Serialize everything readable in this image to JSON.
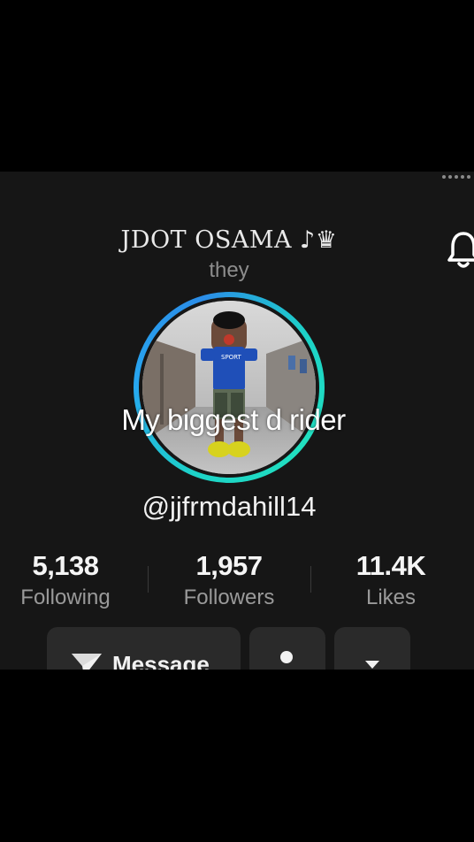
{
  "profile": {
    "display_name": "JDOT OSAMA ♪♛",
    "pronouns": "they",
    "username": "@jjfrmdahill14",
    "overlay_caption": "My biggest d rider"
  },
  "stats": [
    {
      "value": "5,138",
      "label": "Following"
    },
    {
      "value": "1,957",
      "label": "Followers"
    },
    {
      "value": "11.4K",
      "label": "Likes"
    }
  ],
  "actions": {
    "message_label": "Message"
  },
  "icons": {
    "top_right": "more-dots-icon",
    "notifications": "bell-icon",
    "message": "send-icon",
    "friend": "add-friend-icon",
    "more": "caret-down-icon"
  },
  "colors": {
    "background": "#161616",
    "ring_start": "#27a6f0",
    "ring_end": "#1dd3c7",
    "button": "#2a2a2a"
  }
}
